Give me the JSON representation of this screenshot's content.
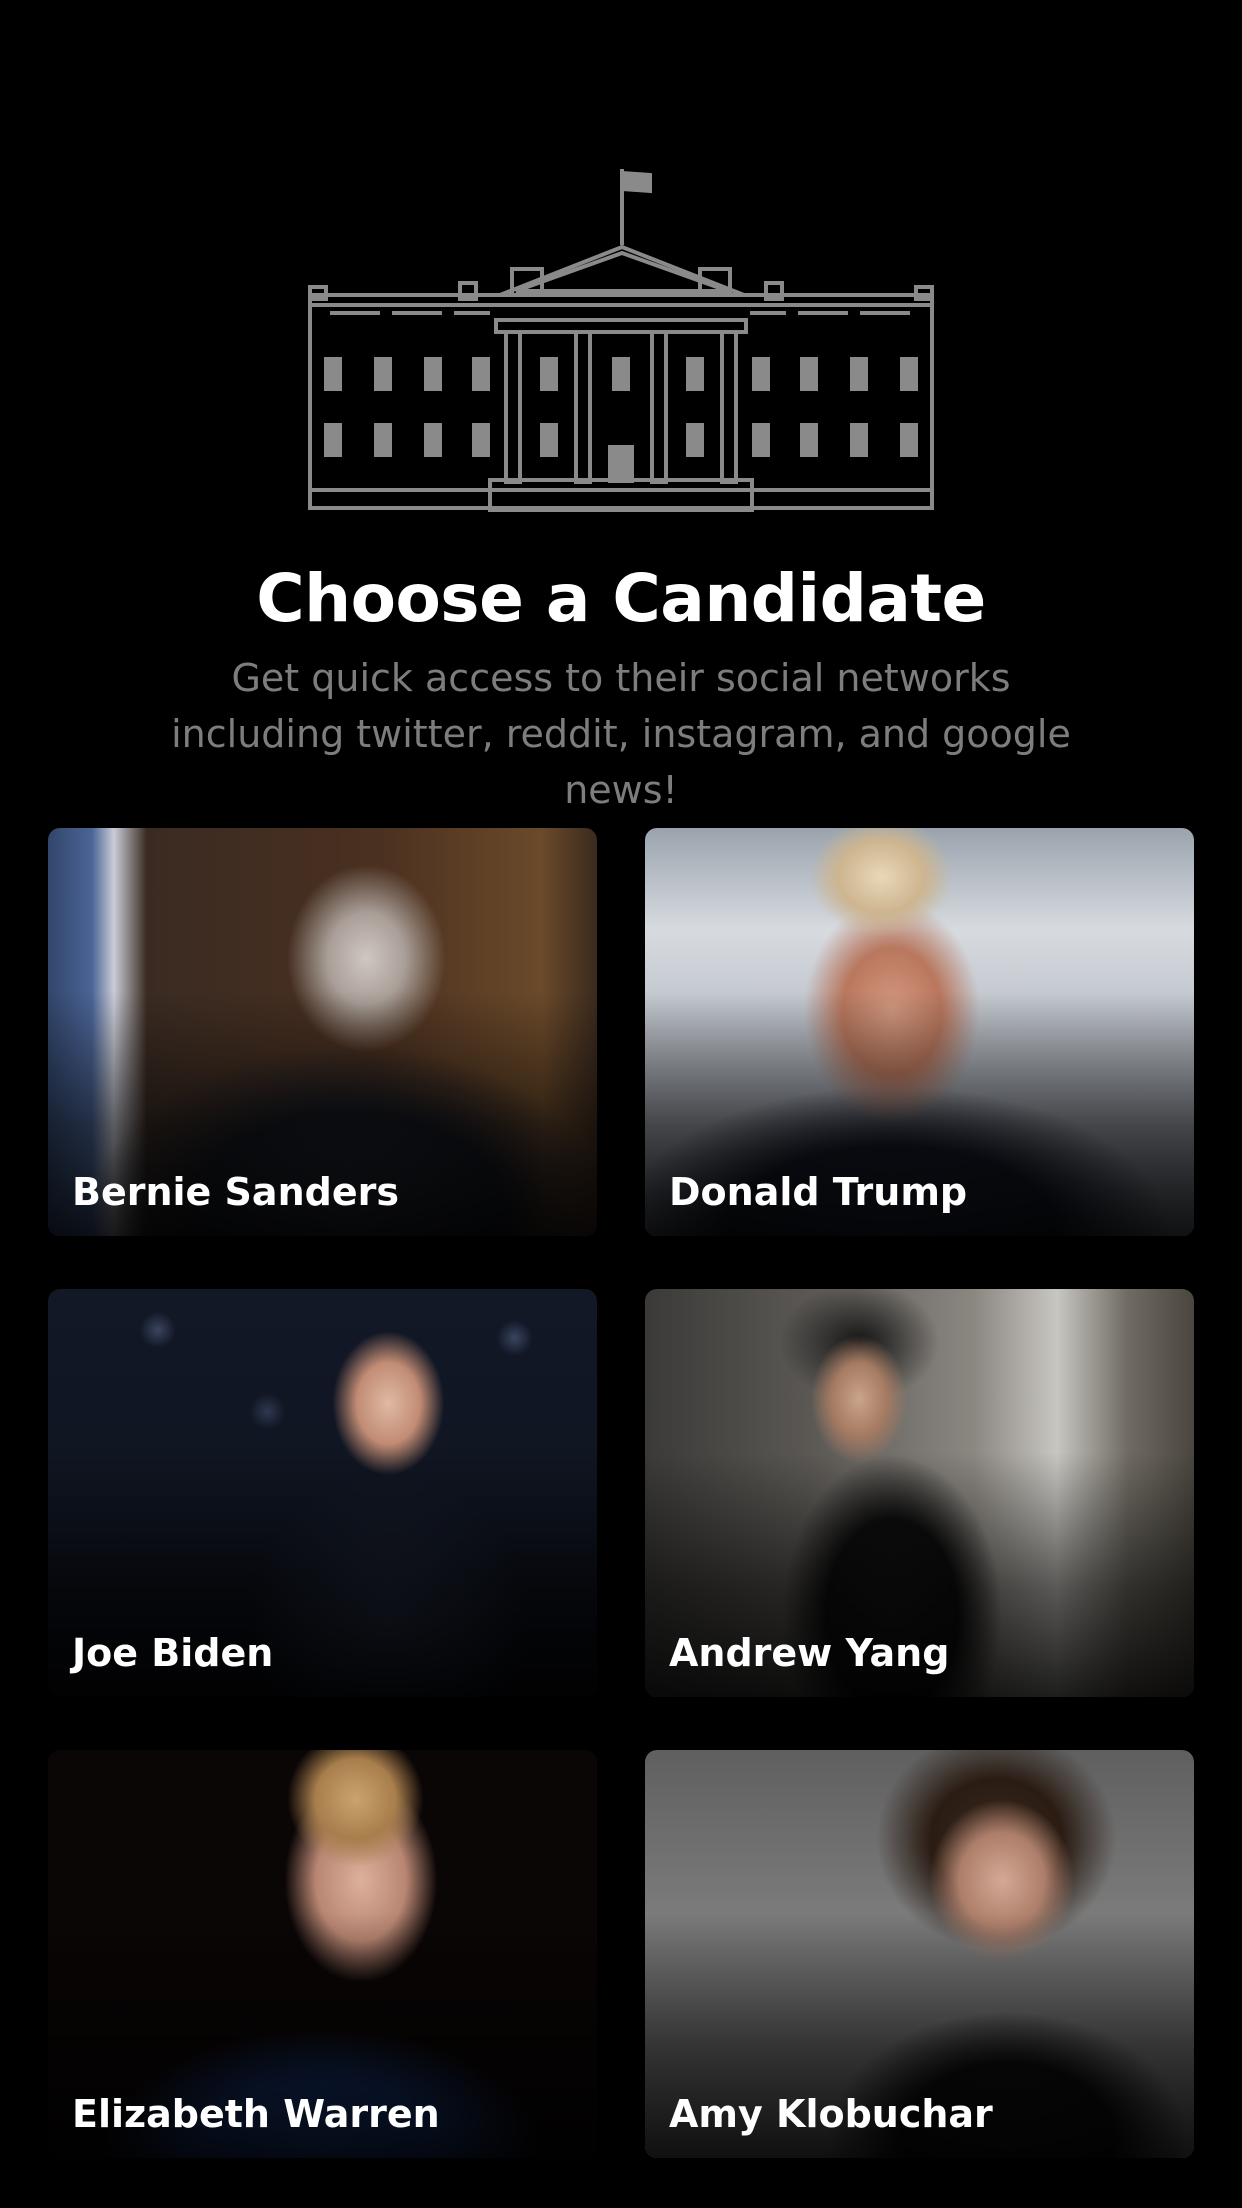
{
  "header": {
    "title": "Choose a Candidate",
    "subtitle": "Get quick access to their social networks including twitter, reddit, instagram, and google news!",
    "icon": "white-house-icon"
  },
  "candidates": [
    {
      "name": "Bernie Sanders"
    },
    {
      "name": "Donald Trump"
    },
    {
      "name": "Joe Biden"
    },
    {
      "name": "Andrew Yang"
    },
    {
      "name": "Elizabeth Warren"
    },
    {
      "name": "Amy Klobuchar"
    }
  ],
  "colors": {
    "background": "#000000",
    "title": "#ffffff",
    "subtitle": "#7d7d7d",
    "icon_stroke": "#8a8a8a"
  }
}
